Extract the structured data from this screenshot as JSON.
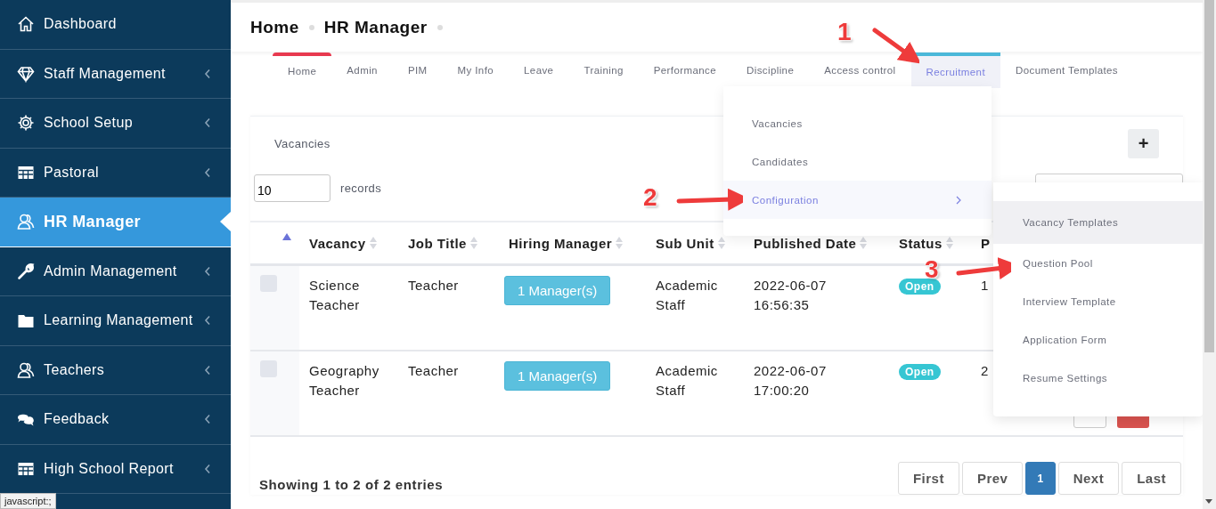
{
  "sidebar": {
    "items": [
      {
        "label": "Dashboard",
        "selected": false,
        "expandable": false
      },
      {
        "label": "Staff Management",
        "selected": false,
        "expandable": true
      },
      {
        "label": "School Setup",
        "selected": false,
        "expandable": true
      },
      {
        "label": "Pastoral",
        "selected": false,
        "expandable": true
      },
      {
        "label": "HR Manager",
        "selected": true,
        "expandable": false
      },
      {
        "label": "Admin Management",
        "selected": false,
        "expandable": true
      },
      {
        "label": "Learning Management",
        "selected": false,
        "expandable": true
      },
      {
        "label": "Teachers",
        "selected": false,
        "expandable": true
      },
      {
        "label": "Feedback",
        "selected": false,
        "expandable": true
      },
      {
        "label": "High School Report",
        "selected": false,
        "expandable": true
      }
    ]
  },
  "status_tooltip": "javascript:;",
  "breadcrumb": [
    "Home",
    "HR Manager"
  ],
  "tabs": [
    {
      "label": "Home",
      "selected": true,
      "expanded": false
    },
    {
      "label": "Admin",
      "selected": false,
      "expanded": false
    },
    {
      "label": "PIM",
      "selected": false,
      "expanded": false
    },
    {
      "label": "My Info",
      "selected": false,
      "expanded": false
    },
    {
      "label": "Leave",
      "selected": false,
      "expanded": false
    },
    {
      "label": "Training",
      "selected": false,
      "expanded": false
    },
    {
      "label": "Performance",
      "selected": false,
      "expanded": false
    },
    {
      "label": "Discipline",
      "selected": false,
      "expanded": false
    },
    {
      "label": "Access control",
      "selected": false,
      "expanded": false
    },
    {
      "label": "Recruitment",
      "selected": false,
      "expanded": true
    },
    {
      "label": "Document Templates",
      "selected": false,
      "expanded": false
    }
  ],
  "recruitment_menu": {
    "items": [
      {
        "label": "Vacancies",
        "highlighted": false,
        "has_submenu": false
      },
      {
        "label": "Candidates",
        "highlighted": false,
        "has_submenu": false
      },
      {
        "label": "Configuration",
        "highlighted": true,
        "has_submenu": true
      }
    ]
  },
  "configuration_submenu": {
    "items": [
      {
        "label": "Vacancy Templates",
        "highlighted": true
      },
      {
        "label": "Question Pool",
        "highlighted": false
      },
      {
        "label": "Interview Template",
        "highlighted": false
      },
      {
        "label": "Application Form",
        "highlighted": false
      },
      {
        "label": "Resume Settings",
        "highlighted": false
      }
    ]
  },
  "vacancies_card": {
    "title": "Vacancies",
    "add_button": "+",
    "page_size": "10",
    "page_size_label": "records",
    "table": {
      "columns": [
        {
          "sorted": true
        },
        {
          "label": "Vacancy",
          "sorted": false
        },
        {
          "label": "Job Title",
          "sorted": false
        },
        {
          "label": "Hiring Manager",
          "sorted": false
        },
        {
          "label": "Sub Unit",
          "sorted": false
        },
        {
          "label": "Published Date",
          "sorted": false
        },
        {
          "label": "Status",
          "sorted": false
        },
        {
          "label": "P"
        }
      ],
      "rows": [
        {
          "checked": false,
          "vacancy": "Science Teacher",
          "job_title": "Teacher",
          "hiring_manager": "1 Manager(s)",
          "sub_unit": "Academic Staff",
          "published_date": "2022-06-07 16:56:35",
          "status": "Open",
          "column_8": "1"
        },
        {
          "checked": false,
          "vacancy": "Geography Teacher",
          "job_title": "Teacher",
          "hiring_manager": "1 Manager(s)",
          "sub_unit": "Academic Staff",
          "published_date": "2022-06-07 17:00:20",
          "status": "Open",
          "column_8": "2"
        }
      ]
    },
    "summary": "Showing 1 to 2 of 2 entries",
    "pagination": [
      {
        "label": "First",
        "selected": false
      },
      {
        "label": "Prev",
        "selected": false
      },
      {
        "label": "1",
        "selected": true
      },
      {
        "label": "Next",
        "selected": false
      },
      {
        "label": "Last",
        "selected": false
      }
    ]
  },
  "annotations": [
    {
      "label": "1"
    },
    {
      "label": "2"
    },
    {
      "label": "3"
    }
  ]
}
